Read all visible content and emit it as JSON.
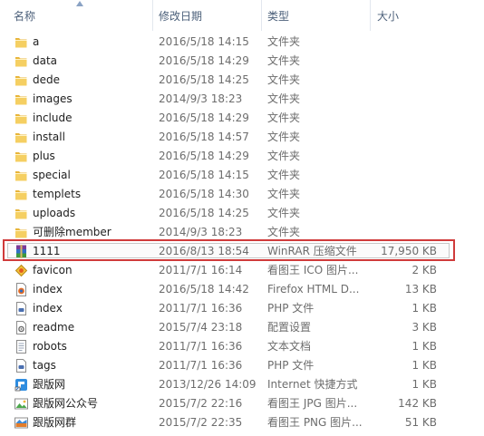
{
  "columns": {
    "name": "名称",
    "modified": "修改日期",
    "type": "类型",
    "size": "大小"
  },
  "files": [
    {
      "name": "a",
      "modified": "2016/5/18 14:15",
      "type": "文件夹",
      "size": "",
      "icon": "folder-icon"
    },
    {
      "name": "data",
      "modified": "2016/5/18 14:29",
      "type": "文件夹",
      "size": "",
      "icon": "folder-icon"
    },
    {
      "name": "dede",
      "modified": "2016/5/18 14:25",
      "type": "文件夹",
      "size": "",
      "icon": "folder-icon"
    },
    {
      "name": "images",
      "modified": "2014/9/3 18:23",
      "type": "文件夹",
      "size": "",
      "icon": "folder-icon"
    },
    {
      "name": "include",
      "modified": "2016/5/18 14:29",
      "type": "文件夹",
      "size": "",
      "icon": "folder-icon"
    },
    {
      "name": "install",
      "modified": "2016/5/18 14:57",
      "type": "文件夹",
      "size": "",
      "icon": "folder-icon"
    },
    {
      "name": "plus",
      "modified": "2016/5/18 14:29",
      "type": "文件夹",
      "size": "",
      "icon": "folder-icon"
    },
    {
      "name": "special",
      "modified": "2016/5/18 14:15",
      "type": "文件夹",
      "size": "",
      "icon": "folder-icon"
    },
    {
      "name": "templets",
      "modified": "2016/5/18 14:30",
      "type": "文件夹",
      "size": "",
      "icon": "folder-icon"
    },
    {
      "name": "uploads",
      "modified": "2016/5/18 14:25",
      "type": "文件夹",
      "size": "",
      "icon": "folder-icon"
    },
    {
      "name": "可删除member",
      "modified": "2014/9/3 18:23",
      "type": "文件夹",
      "size": "",
      "icon": "folder-icon"
    },
    {
      "name": "1111",
      "modified": "2016/8/13 18:54",
      "type": "WinRAR 压缩文件",
      "size": "17,950 KB",
      "icon": "winrar-archive-icon",
      "highlight": true
    },
    {
      "name": "favicon",
      "modified": "2011/7/1 16:14",
      "type": "看图王 ICO 图片...",
      "size": "2 KB",
      "icon": "favicon-image-icon"
    },
    {
      "name": "index",
      "modified": "2016/5/18 14:42",
      "type": "Firefox HTML D...",
      "size": "13 KB",
      "icon": "html-document-icon"
    },
    {
      "name": "index",
      "modified": "2011/7/1 16:36",
      "type": "PHP 文件",
      "size": "1 KB",
      "icon": "php-file-icon"
    },
    {
      "name": "readme",
      "modified": "2015/7/4 23:18",
      "type": "配置设置",
      "size": "3 KB",
      "icon": "settings-file-icon"
    },
    {
      "name": "robots",
      "modified": "2011/7/1 16:36",
      "type": "文本文档",
      "size": "1 KB",
      "icon": "text-document-icon"
    },
    {
      "name": "tags",
      "modified": "2011/7/1 16:36",
      "type": "PHP 文件",
      "size": "1 KB",
      "icon": "php-file-icon"
    },
    {
      "name": "跟版网",
      "modified": "2013/12/26 14:09",
      "type": "Internet 快捷方式",
      "size": "1 KB",
      "icon": "internet-shortcut-icon"
    },
    {
      "name": "跟版网公众号",
      "modified": "2015/7/2 22:16",
      "type": "看图王 JPG 图片...",
      "size": "142 KB",
      "icon": "jpg-image-icon"
    },
    {
      "name": "跟版网群",
      "modified": "2015/7/2 22:35",
      "type": "看图王 PNG 图片...",
      "size": "51 KB",
      "icon": "png-image-icon"
    }
  ]
}
